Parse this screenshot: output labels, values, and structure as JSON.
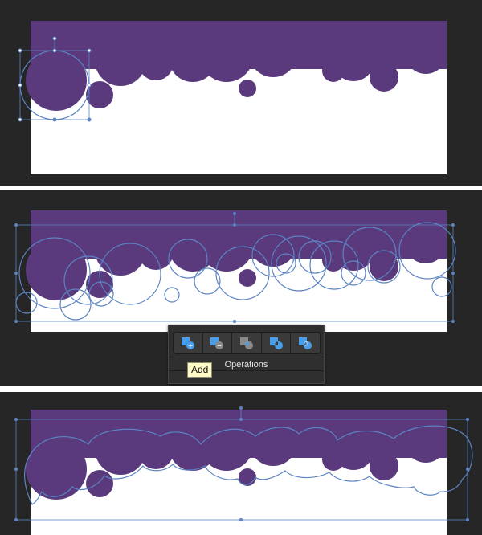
{
  "operations_panel": {
    "title": "Operations",
    "tooltip": "Add",
    "buttons": [
      {
        "name": "add",
        "icon": "shape-add-icon"
      },
      {
        "name": "subtract",
        "icon": "shape-subtract-icon"
      },
      {
        "name": "intersect",
        "icon": "shape-intersect-icon"
      },
      {
        "name": "difference",
        "icon": "shape-difference-icon"
      },
      {
        "name": "divide",
        "icon": "shape-divide-icon"
      }
    ]
  },
  "colors": {
    "background": "#262626",
    "canvas": "#ffffff",
    "cloud_fill": "#5a3a7c",
    "selection": "#5b84c4",
    "tooltip": "#fffac8"
  },
  "steps": [
    {
      "state": "single circle selected"
    },
    {
      "state": "all circles selected"
    },
    {
      "state": "circles merged into one path"
    }
  ]
}
